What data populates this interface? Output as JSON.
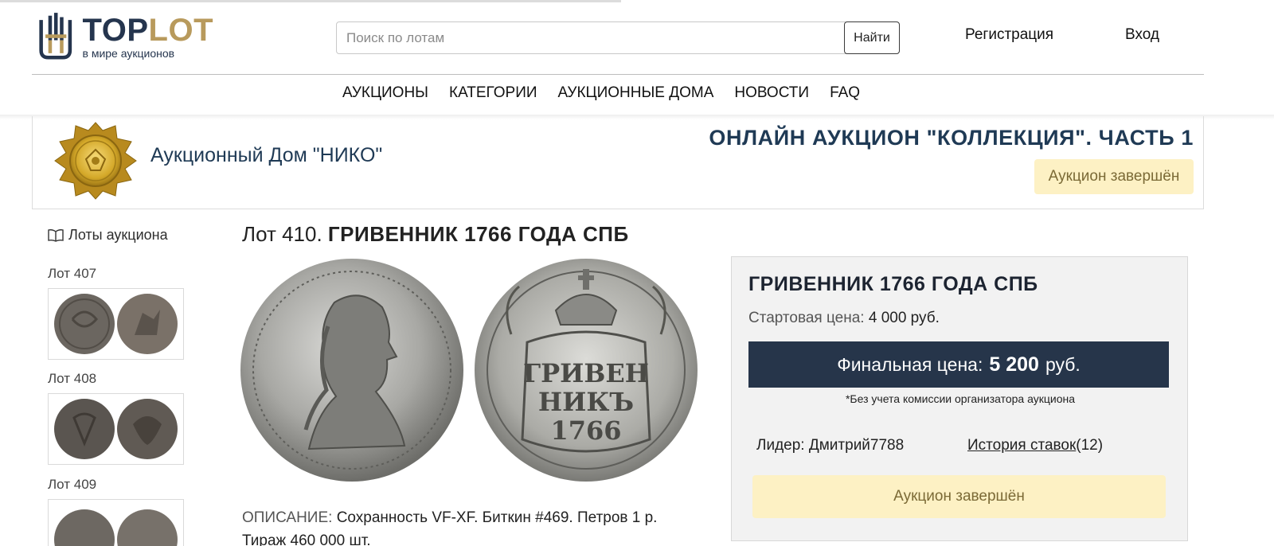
{
  "brand": {
    "name_part1": "TOP",
    "name_part2": "LOT",
    "tagline": "в мире аукционов",
    "colors": {
      "navy": "#25354e",
      "gold": "#b89a5c"
    }
  },
  "search": {
    "placeholder": "Поиск по лотам",
    "button_label": "Найти"
  },
  "auth": {
    "register_label": "Регистрация",
    "login_label": "Вход"
  },
  "nav": {
    "items": [
      "АУКЦИОНЫ",
      "КАТЕГОРИИ",
      "АУКЦИОННЫЕ ДОМА",
      "НОВОСТИ",
      "FAQ"
    ]
  },
  "auction_house": {
    "name": "Аукционный Дом \"НИКО\"",
    "auction_title": "ОНЛАЙН АУКЦИОН \"КОЛЛЕКЦИЯ\". ЧАСТЬ 1",
    "status": "Аукцион завершён"
  },
  "sidebar": {
    "heading": "Лоты аукциона",
    "lots": [
      {
        "label": "Лот 407"
      },
      {
        "label": "Лот 408"
      },
      {
        "label": "Лот 409"
      }
    ]
  },
  "lot": {
    "number_text": "Лот 410.",
    "title": "ГРИВЕННИК 1766 ГОДА СПБ",
    "description_label": "ОПИСАНИЕ:",
    "description_text": "Сохранность VF-XF. Биткин #469. Петров 1 р. Тираж 460 000 шт."
  },
  "price_box": {
    "title": "ГРИВЕННИК 1766 ГОДА СПБ",
    "start_label": "Стартовая цена:",
    "start_value": "4 000 руб.",
    "final_label": "Финальная цена:",
    "final_value": "5 200",
    "final_currency": "руб.",
    "commission_note": "*Без учета комиссии организатора аукциона",
    "leader_label": "Лидер:",
    "leader_value": "Дмитрий7788",
    "history_label": "История ставок",
    "history_count": "(12)",
    "status": "Аукцион завершён"
  }
}
